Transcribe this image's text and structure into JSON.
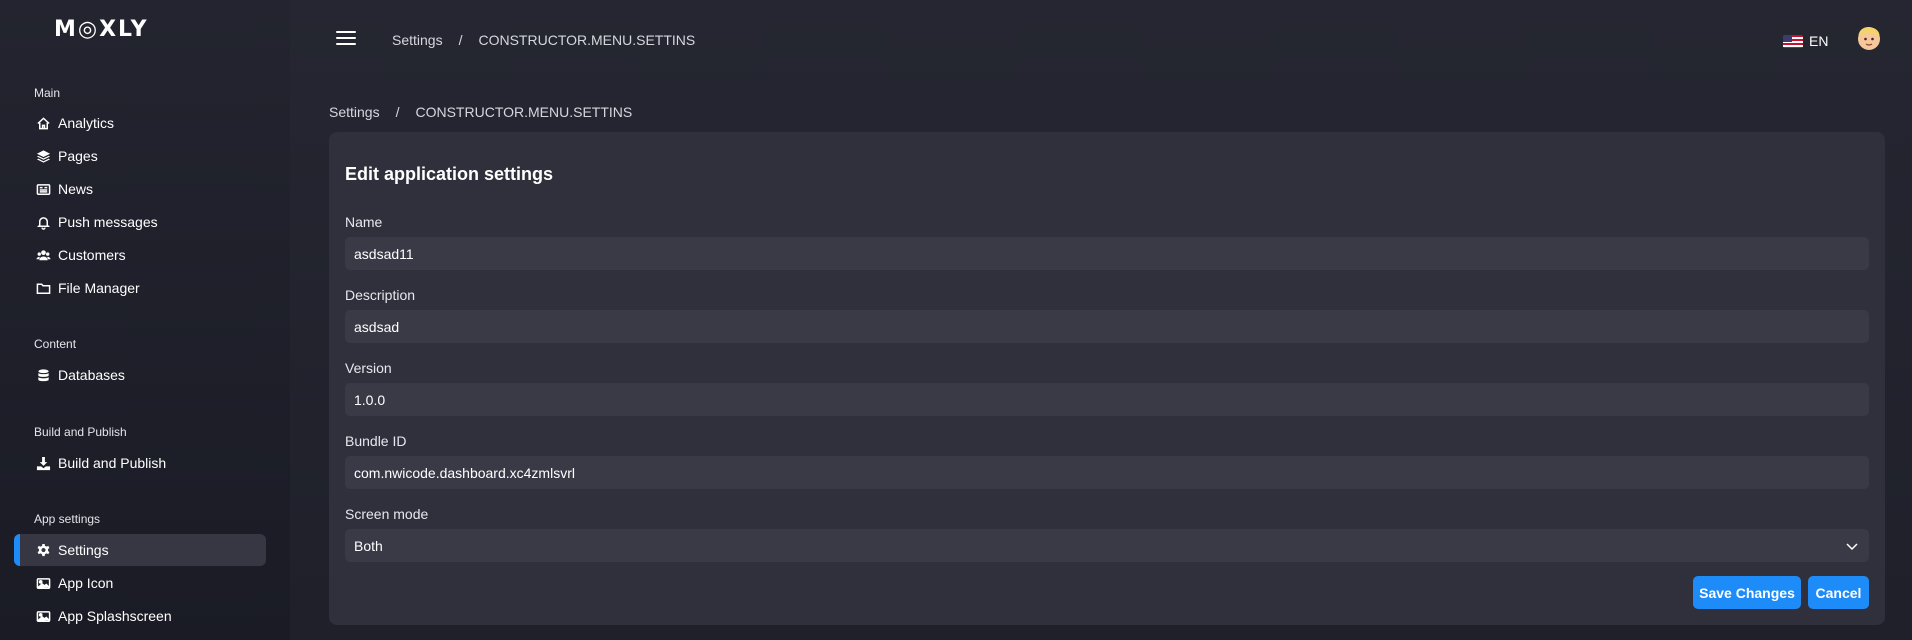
{
  "app": {
    "logo_text": "M◎XLY"
  },
  "topbar": {
    "breadcrumb": [
      "Settings",
      "/",
      "CONSTRUCTOR.MENU.SETTINS"
    ],
    "language": "EN"
  },
  "sidebar": {
    "sections": [
      {
        "title": "Main",
        "items": [
          {
            "label": "Analytics",
            "icon": "home-icon"
          },
          {
            "label": "Pages",
            "icon": "layers-icon"
          },
          {
            "label": "News",
            "icon": "newspaper-icon"
          },
          {
            "label": "Push messages",
            "icon": "bell-icon"
          },
          {
            "label": "Customers",
            "icon": "users-icon"
          },
          {
            "label": "File Manager",
            "icon": "folder-icon"
          }
        ]
      },
      {
        "title": "Content",
        "items": [
          {
            "label": "Databases",
            "icon": "database-icon"
          }
        ]
      },
      {
        "title": "Build and Publish",
        "items": [
          {
            "label": "Build and Publish",
            "icon": "download-icon"
          }
        ]
      },
      {
        "title": "App settings",
        "items": [
          {
            "label": "Settings",
            "icon": "gear-icon",
            "active": true
          },
          {
            "label": "App Icon",
            "icon": "image-icon"
          },
          {
            "label": "App Splashscreen",
            "icon": "image-icon"
          }
        ]
      }
    ]
  },
  "breadcrumb": [
    "Settings",
    "/",
    "CONSTRUCTOR.MENU.SETTINS"
  ],
  "form": {
    "title": "Edit application settings",
    "fields": [
      {
        "label": "Name",
        "value": "asdsad11"
      },
      {
        "label": "Description",
        "value": "asdsad"
      },
      {
        "label": "Version",
        "value": "1.0.0"
      },
      {
        "label": "Bundle ID",
        "value": "com.nwicode.dashboard.xc4zmlsvrl"
      }
    ],
    "screen_mode": {
      "label": "Screen mode",
      "value": "Both"
    },
    "save_label": "Save Changes",
    "cancel_label": "Cancel"
  },
  "colors": {
    "accent": "#1d8cf8",
    "background": "#22232e",
    "card": "#2f303b",
    "input": "#393a46"
  }
}
